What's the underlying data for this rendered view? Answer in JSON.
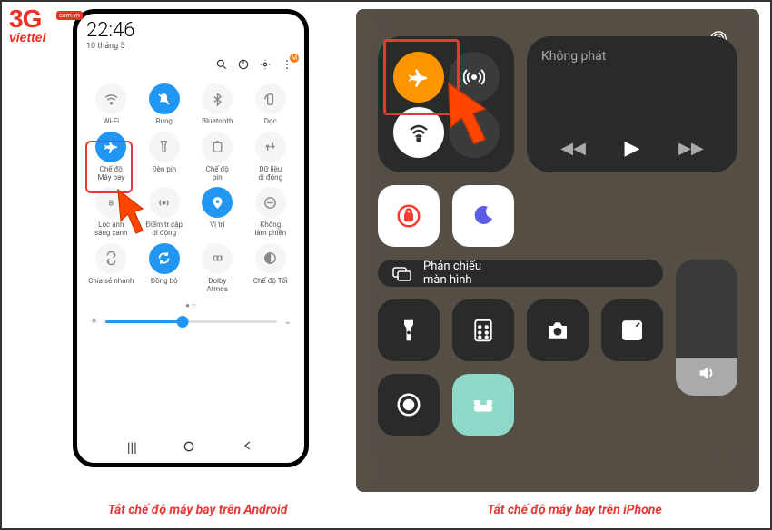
{
  "logo": {
    "brand": "3G",
    "sub": "viettel",
    "badge": "com.vn"
  },
  "captions": {
    "android": "Tắt chế độ máy bay trên Android",
    "iphone": "Tắt chế độ máy bay trên iPhone"
  },
  "android": {
    "time": "22:46",
    "date": "10 tháng 5",
    "toggles": [
      {
        "label": "Wi-Fi"
      },
      {
        "label": "Rung"
      },
      {
        "label": "Bluetooth"
      },
      {
        "label": "Dọc"
      },
      {
        "label": "Chế độ\nMáy bay"
      },
      {
        "label": "Đèn pin"
      },
      {
        "label": "Chế độ\npin"
      },
      {
        "label": "Dữ liệu\ndi động"
      },
      {
        "label": "Lọc ánh\nsáng xanh"
      },
      {
        "label": "Điểm tr.cập\ndi động"
      },
      {
        "label": "Vị trí"
      },
      {
        "label": "Không\nlàm phiền"
      },
      {
        "label": "Chia sẻ nhanh"
      },
      {
        "label": "Đồng bộ"
      },
      {
        "label": "Dolby\nAtmos"
      },
      {
        "label": "Chế độ Tối"
      }
    ]
  },
  "iphone": {
    "media_title": "Không phát",
    "mirror_label": "Phản chiếu\nmàn hình"
  }
}
